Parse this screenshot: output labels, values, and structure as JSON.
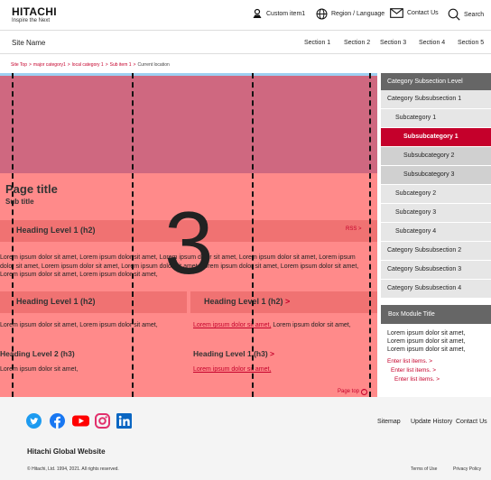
{
  "header": {
    "brand": "HITACHI",
    "tagline": "Inspire the Next",
    "custom_item": "Custom item1",
    "region": "Region / Language",
    "contact": "Contact Us",
    "search": "Search"
  },
  "sitebar": {
    "site_name": "Site Name",
    "nav": [
      "Section 1",
      "Section 2",
      "Section 3",
      "Section 4",
      "Section 5"
    ]
  },
  "breadcrumb": {
    "items": [
      "Site Top",
      "major category1",
      "local category 1",
      "Sub item 1"
    ],
    "current": "Current location",
    "sep": ">"
  },
  "overlay": {
    "label": "3"
  },
  "content": {
    "page_title": "Page title",
    "sub_title": "Sub title",
    "h2_full": "Heading Level 1 (h2)",
    "rss": "RSS >",
    "para_full": "Lorem ipsum dolor sit amet, Lorem ipsum dolor sit amet, Lorem ipsum dolor sit amet, Lorem ipsum dolor sit amet, Lorem ipsum dolor sit amet, Lorem ipsum dolor sit amet, Lorem ipsum dolor sit amet, Lorem ipsum dolor sit amet, Lorem ipsum dolor sit amet, Lorem ipsum dolor sit amet, Lorem ipsum dolor sit amet,",
    "left": {
      "h2": "Heading Level 1 (h2)",
      "para": "Lorem ipsum dolor sit amet, Lorem ipsum dolor sit amet,",
      "h3": "Heading Level 2 (h3)",
      "para2": "Lorem ipsum dolor sit amet,"
    },
    "right": {
      "h2": "Heading Level 1 (h2)",
      "h2_arrow": ">",
      "link": "Lorem ipsum dolor sit amet,",
      "para_rest": "Lorem ipsum dolor sit amet,",
      "h3": "Heading Level 1 (h3)",
      "h3_arrow": ">",
      "link2": "Lorem ipsum dolor sit amet,"
    },
    "page_top": "Page top"
  },
  "sidebar": {
    "header": "Category Subsection Level",
    "items": [
      {
        "label": "Category Subsubsection 1",
        "level": 1
      },
      {
        "label": "Subcategory 1",
        "level": 2
      },
      {
        "label": "Subsubcategory 1",
        "level": 3,
        "active": true
      },
      {
        "label": "Subsubcategory 2",
        "level": 3
      },
      {
        "label": "Subsubcategory 3",
        "level": 3
      },
      {
        "label": "Subcategory 2",
        "level": 2
      },
      {
        "label": "Subcategory 3",
        "level": 2
      },
      {
        "label": "Subcategory 4",
        "level": 2
      },
      {
        "label": "Category Subsubsection 2",
        "level": 1
      },
      {
        "label": "Category Subsubsection 3",
        "level": 1
      },
      {
        "label": "Category Subsubsection 4",
        "level": 1
      }
    ],
    "box_title": "Box Module Title",
    "box_lines": [
      "Lorem ipsum dolor sit amet,",
      "Lorem ipsum dolor sit amet,",
      "Lorem ipsum dolor sit amet,"
    ],
    "box_links": [
      "Enter list items.  >",
      "Enter list items.  >",
      "Enter list items.  >"
    ]
  },
  "footer": {
    "social": [
      "twitter-icon",
      "facebook-icon",
      "youtube-icon",
      "instagram-icon",
      "linkedin-icon"
    ],
    "nav": [
      "Sitemap",
      "Update History",
      "Contact Us"
    ],
    "site": "Hitachi Global Website",
    "copyright": "© Hitachi, Ltd. 1994, 2021. All rights reserved.",
    "legal": [
      "Terms of Use",
      "Privacy Policy"
    ]
  },
  "colors": {
    "accent": "#c5002b",
    "overlay_main": "#ff8a8a",
    "overlay_hero": "#cf6880",
    "sidebar_header": "#666666"
  }
}
